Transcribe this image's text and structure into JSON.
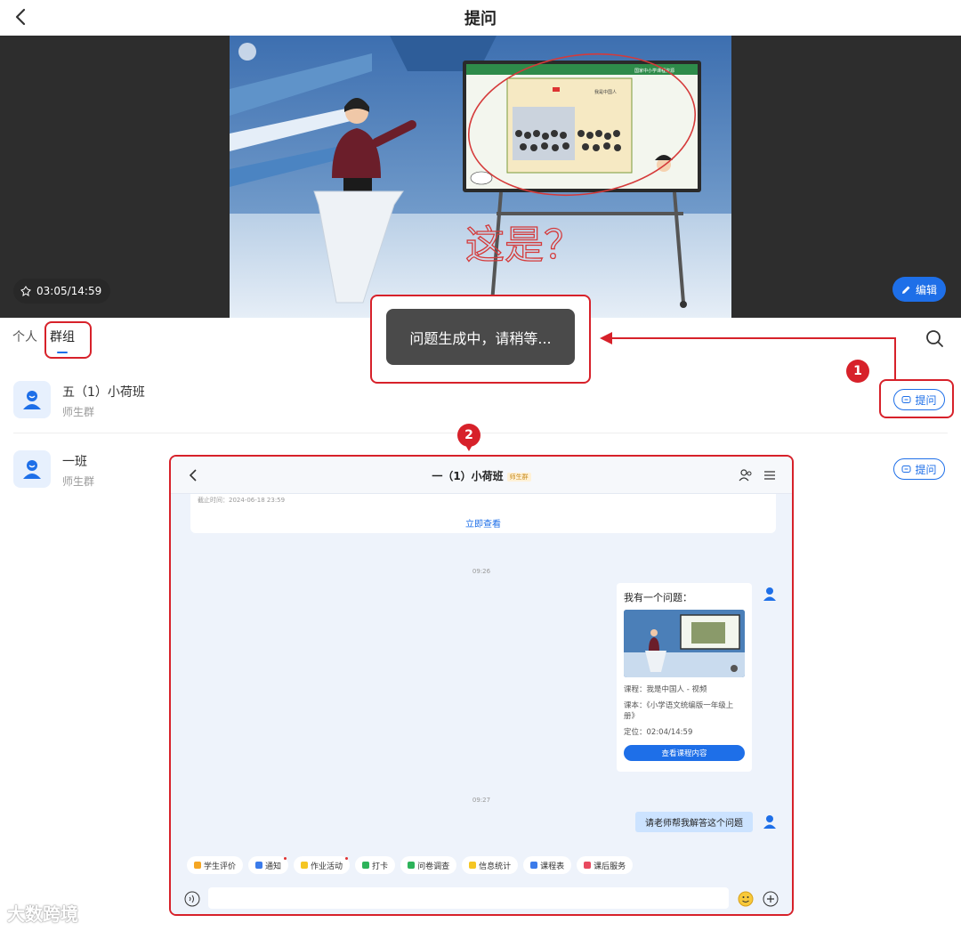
{
  "header": {
    "title": "提问"
  },
  "video": {
    "timestamp": "03:05/14:59",
    "edit_label": "编辑",
    "board_title": "国家中小学课程资源",
    "board_page_title": "我是中国人",
    "handwriting": "这是？"
  },
  "tabs": [
    {
      "label": "个人"
    },
    {
      "label": "群组"
    }
  ],
  "toast": {
    "text": "问题生成中，请稍等..."
  },
  "groups": [
    {
      "name": "五（1）小荷班",
      "sub": "师生群",
      "ask_label": "提问"
    },
    {
      "name": "一班",
      "sub": "师生群",
      "ask_label": "提问"
    }
  ],
  "badges": [
    "1",
    "2"
  ],
  "chat": {
    "title": "一（1）小荷班",
    "tag": "师生群",
    "deadline": "截止时间：2024-06-18 23:59",
    "view_now": "立即查看",
    "time1": "09:26",
    "time2": "09:27",
    "card": {
      "question": "我有一个问题：",
      "course": "课程：我是中国人 - 视频",
      "textbook": "课本：《小学语文统编版一年级上册》",
      "position": "定位：02:04/14:59",
      "button": "查看课程内容"
    },
    "message": "请老师帮我解答这个问题",
    "tools": [
      {
        "label": "学生评价",
        "color": "#f5a623",
        "dot": false
      },
      {
        "label": "通知",
        "color": "#3b7bea",
        "dot": true
      },
      {
        "label": "作业活动",
        "color": "#f5c623",
        "dot": true
      },
      {
        "label": "打卡",
        "color": "#2db35a",
        "dot": false
      },
      {
        "label": "问卷调查",
        "color": "#2db35a",
        "dot": false
      },
      {
        "label": "信息统计",
        "color": "#f5c623",
        "dot": false
      },
      {
        "label": "课程表",
        "color": "#3b7bea",
        "dot": false
      },
      {
        "label": "课后服务",
        "color": "#e84a5f",
        "dot": false
      }
    ]
  },
  "watermark": "大数跨境",
  "colors": {
    "accent": "#1e6fe8",
    "highlight": "#d7212a",
    "toast_bg": "#4a4a4a"
  }
}
